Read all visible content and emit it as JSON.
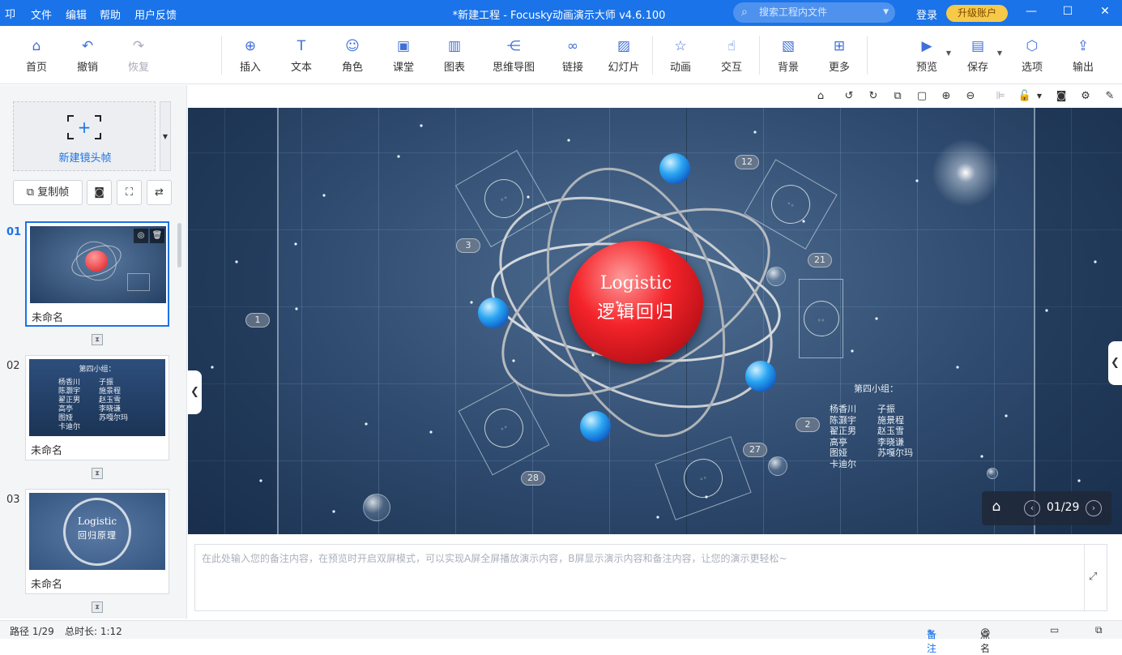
{
  "titlebar": {
    "logo": "卭",
    "menus": [
      "文件",
      "编辑",
      "帮助",
      "用户反馈"
    ],
    "title": "*新建工程 - Focusky动画演示大师  v4.6.100",
    "search_placeholder": "搜索工程内文件",
    "login": "登录",
    "upgrade": "升级账户"
  },
  "toolbar": {
    "home": "首页",
    "undo": "撤销",
    "redo": "恢复",
    "insert": "插入",
    "text": "文本",
    "role": "角色",
    "classroom": "课堂",
    "chart": "图表",
    "mindmap": "思维导图",
    "link": "链接",
    "slide": "幻灯片",
    "animation": "动画",
    "interaction": "交互",
    "background": "背景",
    "more": "更多",
    "preview": "预览",
    "save": "保存",
    "options": "选项",
    "export": "输出"
  },
  "sidebar": {
    "new_frame": "新建镜头帧",
    "copy_frame": "复制帧",
    "slides": [
      {
        "num": "01",
        "name": "未命名"
      },
      {
        "num": "02",
        "name": "未命名",
        "thumb_title": "第四小组：",
        "thumb_col1": [
          "杨香川",
          "陈灏宇",
          "翟正男",
          "高亭",
          "图娅",
          "卡迪尔"
        ],
        "thumb_col2": [
          "子振",
          "施景程",
          "赵玉雪",
          "李晓谦",
          "苏嘎尔玛"
        ]
      },
      {
        "num": "03",
        "name": "未命名",
        "thumb_t1": "Logistic",
        "thumb_t2": "回归原理"
      }
    ]
  },
  "stage": {
    "core_title": "Logistic",
    "core_subtitle": "逻辑回归",
    "badges": [
      "1",
      "2",
      "3",
      "12",
      "21",
      "27",
      "28"
    ],
    "group_title": "第四小组：",
    "group_col1": [
      "杨香川",
      "陈灏宇",
      "翟正男",
      "高亭",
      "图娅",
      "卡迪尔"
    ],
    "group_col2": [
      "子振",
      "施景程",
      "赵玉雪",
      "李晓谦",
      "苏嘎尔玛"
    ],
    "page": "01/29"
  },
  "notes": {
    "placeholder": "在此处输入您的备注内容，在预览时开启双屏模式，可以实现A屏全屏播放演示内容，B屏显示演示内容和备注内容，让您的演示更轻松~"
  },
  "status": {
    "path": "路径 1/29",
    "duration": "总时长: 1:12",
    "notes": "备注",
    "rollcall": "点名"
  }
}
